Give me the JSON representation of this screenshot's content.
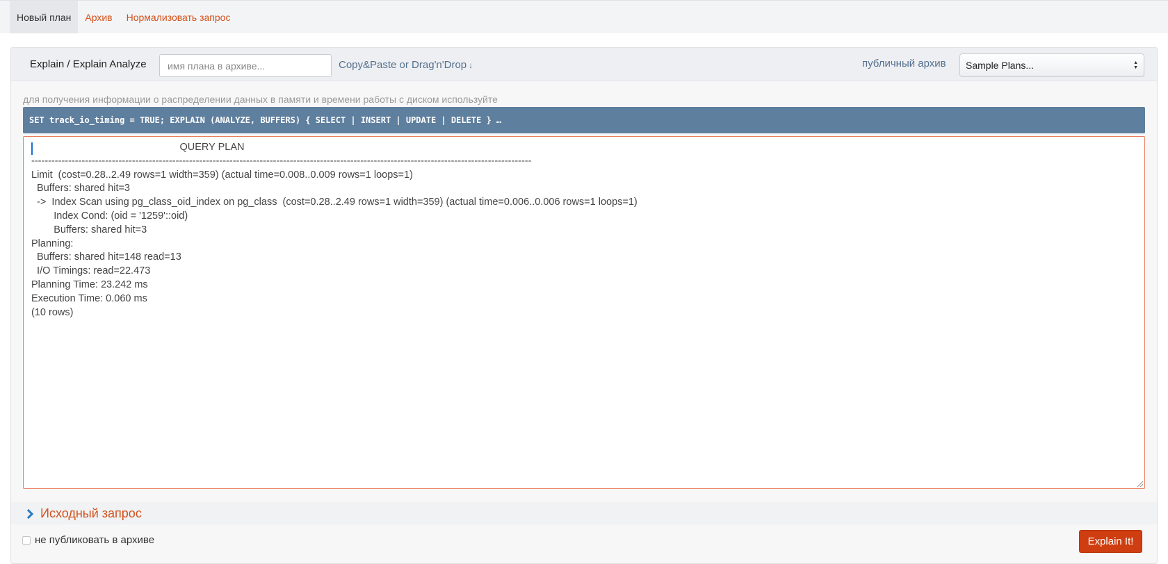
{
  "nav": {
    "tabs": [
      {
        "label": "Новый план",
        "active": true
      },
      {
        "label": "Архив",
        "active": false
      },
      {
        "label": "Нормализовать запрос",
        "active": false
      }
    ]
  },
  "form": {
    "explain_label": "Explain / Explain Analyze",
    "plan_name_placeholder": "имя плана в архиве...",
    "copy_paste_label": "Copy&Paste or Drag'n'Drop",
    "copy_paste_arrow": "↓",
    "public_archive_label": "публичный архив",
    "sample_select_value": "Sample Plans...",
    "hint": "для получения информации о распределении данных в памяти и времени работы с диском используйте",
    "command": "SET track_io_timing = TRUE; EXPLAIN (ANALYZE, BUFFERS) { SELECT | INSERT | UPDATE | DELETE } …",
    "plan_text": "                                                     QUERY PLAN\n-----------------------------------------------------------------------------------------------------------------------------------------------------\nLimit  (cost=0.28..2.49 rows=1 width=359) (actual time=0.008..0.009 rows=1 loops=1)\n  Buffers: shared hit=3\n  ->  Index Scan using pg_class_oid_index on pg_class  (cost=0.28..2.49 rows=1 width=359) (actual time=0.006..0.006 rows=1 loops=1)\n        Index Cond: (oid = '1259'::oid)\n        Buffers: shared hit=3\nPlanning:\n  Buffers: shared hit=148 read=13\n  I/O Timings: read=22.473\nPlanning Time: 23.242 ms\nExecution Time: 0.060 ms\n(10 rows)",
    "source_query_label": "Исходный запрос",
    "no_publish_label": "не публиковать в архиве",
    "no_publish_checked": false,
    "submit_label": "Explain It!"
  },
  "colors": {
    "accent": "#d2511b",
    "link": "#54708f",
    "command_bar": "#5f7f9f",
    "button": "#cf3e10",
    "chevron": "#2a7bc0"
  },
  "icons": {
    "copy_paste_arrow": "arrow-down-icon",
    "section_toggle": "chevron-right-icon",
    "select_arrows": "updown-arrows-icon"
  }
}
